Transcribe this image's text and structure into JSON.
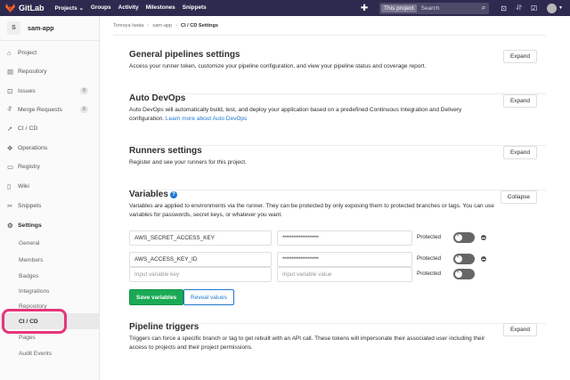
{
  "navbar": {
    "brand": "GitLab",
    "links": [
      "Projects ⌄",
      "Groups",
      "Activity",
      "Milestones",
      "Snippets"
    ],
    "search_scope": "This project",
    "search_placeholder": "Search",
    "bg_color": "#2e2a4f"
  },
  "project": {
    "avatar_letter": "S",
    "name": "sam-app"
  },
  "sidebar": {
    "items": [
      {
        "label": "Project",
        "icon": "house-icon"
      },
      {
        "label": "Repository",
        "icon": "doc-icon"
      },
      {
        "label": "Issues",
        "icon": "issues-icon",
        "badge": "0"
      },
      {
        "label": "Merge Requests",
        "icon": "merge-icon",
        "badge": "0"
      },
      {
        "label": "CI / CD",
        "icon": "rocket-icon"
      },
      {
        "label": "Operations",
        "icon": "operations-icon"
      },
      {
        "label": "Registry",
        "icon": "registry-icon"
      },
      {
        "label": "Wiki",
        "icon": "book-icon"
      },
      {
        "label": "Snippets",
        "icon": "scissors-icon"
      },
      {
        "label": "Settings",
        "icon": "gear-icon"
      }
    ],
    "settings_sub": [
      "General",
      "Members",
      "Badges",
      "Integrations",
      "Repository",
      "CI / CD",
      "Pages",
      "Audit Events"
    ],
    "active_sub": "CI / CD"
  },
  "breadcrumb": [
    "Tomoya Iwata",
    "sam-app",
    "CI / CD Settings"
  ],
  "sections": {
    "general": {
      "title": "General pipelines settings",
      "desc": "Access your runner token, customize your pipeline configuration, and view your pipeline status and coverage report.",
      "button": "Expand"
    },
    "autodevops": {
      "title": "Auto DevOps",
      "desc": "Auto DevOps will automatically build, test, and deploy your application based on a predefined Continuous Integration and Delivery configuration.",
      "link": "Learn more about Auto DevOps",
      "button": "Expand"
    },
    "runners": {
      "title": "Runners settings",
      "desc": "Register and see your runners for this project.",
      "button": "Expand"
    },
    "variables": {
      "title": "Variables",
      "desc": "Variables are applied to environments via the runner. They can be protected by only exposing them to protected branches or tags. You can use variables for passwords, secret keys, or whatever you want.",
      "button": "Collapse",
      "rows": [
        {
          "key": "AWS_SECRET_ACCESS_KEY",
          "value": "********************",
          "protected_label": "Protected"
        },
        {
          "key": "AWS_ACCESS_KEY_ID",
          "value": "********************",
          "protected_label": "Protected"
        }
      ],
      "new_row": {
        "key_placeholder": "Input variable key",
        "value_placeholder": "Input variable value",
        "protected_label": "Protected"
      },
      "save_label": "Save variables",
      "reveal_label": "Reveal values"
    },
    "triggers": {
      "title": "Pipeline triggers",
      "desc": "Triggers can force a specific branch or tag to get rebuilt with an API call. These tokens will impersonate their associated user including their access to projects and their project permissions.",
      "button": "Expand"
    }
  },
  "colors": {
    "accent": "#1f78d1",
    "save": "#1aaa55",
    "highlight": "#e5357b"
  }
}
